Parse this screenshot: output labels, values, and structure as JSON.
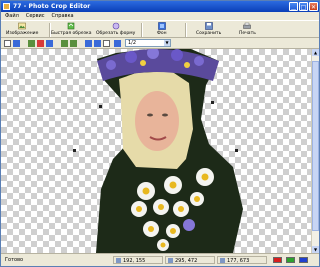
{
  "window": {
    "title": "77 - Photo Crop Editor"
  },
  "menu": [
    "Файл",
    "Сервис",
    "Справка"
  ],
  "toolbar": {
    "items": [
      {
        "label": "Изображение",
        "icon": "image-icon"
      },
      {
        "label": "Быстрая обрезка",
        "icon": "quick-crop-icon"
      },
      {
        "label": "Обрезать форму",
        "icon": "crop-shape-icon"
      },
      {
        "label": "Фон",
        "icon": "background-icon"
      },
      {
        "label": "Сохранить",
        "icon": "save-icon"
      },
      {
        "label": "Печать",
        "icon": "print-icon"
      }
    ]
  },
  "zoom": {
    "value": "1/2"
  },
  "statusbar": {
    "status": "Готово",
    "cursor": "192, 155",
    "size": "295, 472",
    "selection": "177, 673",
    "swatches": [
      "#d81e1e",
      "#2ea12e",
      "#2040d0"
    ]
  },
  "colors": {
    "titlebar": "#0a3fb8",
    "checker": "#cfcfcf",
    "background": "#ece9d8"
  }
}
